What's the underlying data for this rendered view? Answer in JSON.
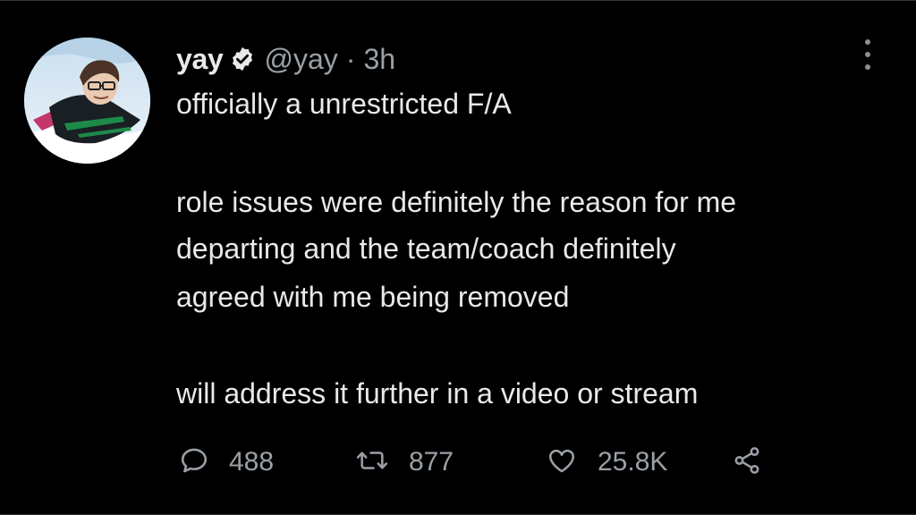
{
  "author": {
    "display_name": "yay",
    "handle": "@yay",
    "separator": "·",
    "time": "3h",
    "verified": true
  },
  "tweet": {
    "lines": [
      "officially a unrestricted F/A",
      "role issues were definitely the reason for me",
      "departing and the team/coach definitely",
      "agreed with me being removed",
      "will address it further in a video or stream"
    ]
  },
  "actions": {
    "replies": "488",
    "retweets": "877",
    "likes": "25.8K"
  },
  "colors": {
    "background": "#000000",
    "text": "#e7e9ea",
    "secondary": "#9aa0a6",
    "verified_badge": "#e7e9ea"
  },
  "icons": [
    "avatar-image",
    "verified-badge-icon",
    "more-options-icon",
    "reply-icon",
    "retweet-icon",
    "like-icon",
    "share-icon"
  ]
}
